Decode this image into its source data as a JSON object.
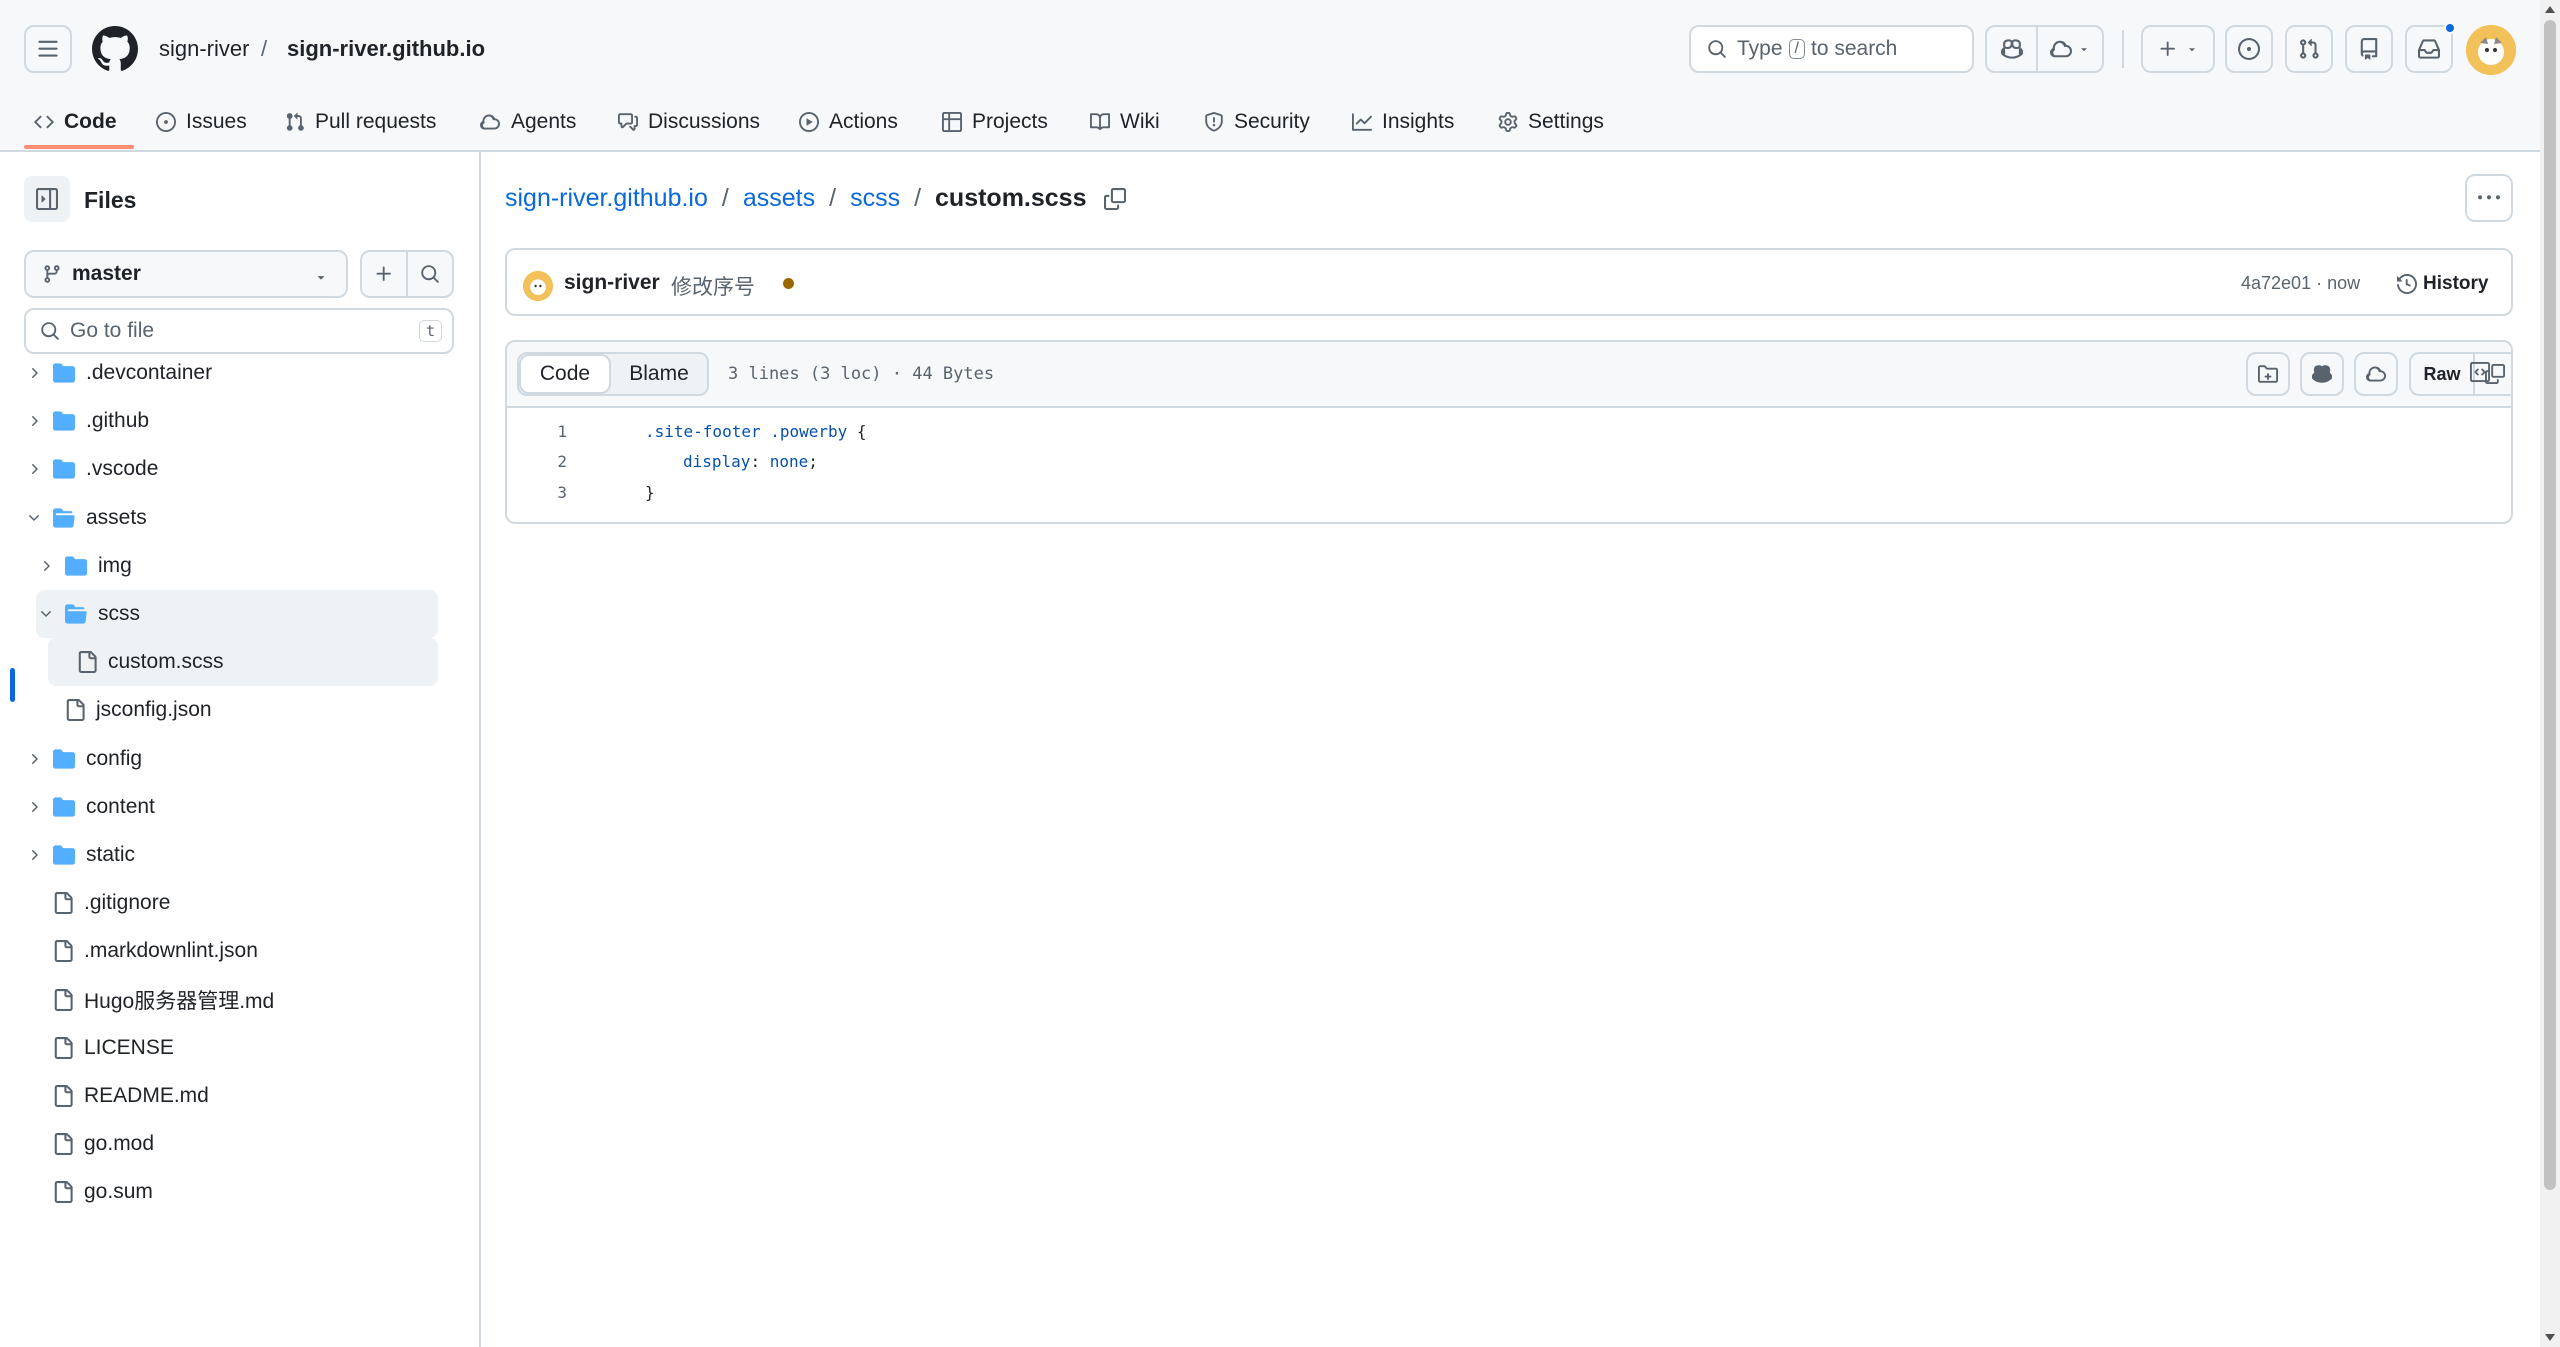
{
  "header": {
    "owner": "sign-river",
    "separator": "/",
    "repo": "sign-river.github.io",
    "search_prefix": "Type",
    "search_key": "/",
    "search_suffix": "to search"
  },
  "repo_nav": [
    {
      "label": "Code",
      "icon": "code-icon",
      "active": true
    },
    {
      "label": "Issues",
      "icon": "issue-icon"
    },
    {
      "label": "Pull requests",
      "icon": "git-pull-request-icon"
    },
    {
      "label": "Agents",
      "icon": "agents-icon"
    },
    {
      "label": "Discussions",
      "icon": "comment-discussion-icon"
    },
    {
      "label": "Actions",
      "icon": "play-icon"
    },
    {
      "label": "Projects",
      "icon": "table-icon"
    },
    {
      "label": "Wiki",
      "icon": "book-icon"
    },
    {
      "label": "Security",
      "icon": "shield-icon"
    },
    {
      "label": "Insights",
      "icon": "graph-icon"
    },
    {
      "label": "Settings",
      "icon": "gear-icon"
    }
  ],
  "sidebar": {
    "title": "Files",
    "branch": "master",
    "goto_placeholder": "Go to file",
    "goto_key": "t",
    "tree": [
      {
        "name": ".devcontainer",
        "type": "folder",
        "depth": 0,
        "expanded": false
      },
      {
        "name": ".github",
        "type": "folder",
        "depth": 0,
        "expanded": false
      },
      {
        "name": ".vscode",
        "type": "folder",
        "depth": 0,
        "expanded": false
      },
      {
        "name": "assets",
        "type": "folder",
        "depth": 0,
        "expanded": true
      },
      {
        "name": "img",
        "type": "folder",
        "depth": 1,
        "expanded": false
      },
      {
        "name": "scss",
        "type": "folder",
        "depth": 1,
        "expanded": true
      },
      {
        "name": "custom.scss",
        "type": "file",
        "depth": 2,
        "selected": true
      },
      {
        "name": "jsconfig.json",
        "type": "file",
        "depth": 1
      },
      {
        "name": "config",
        "type": "folder",
        "depth": 0,
        "expanded": false
      },
      {
        "name": "content",
        "type": "folder",
        "depth": 0,
        "expanded": false
      },
      {
        "name": "static",
        "type": "folder",
        "depth": 0,
        "expanded": false
      },
      {
        "name": ".gitignore",
        "type": "file",
        "depth": 0
      },
      {
        "name": ".markdownlint.json",
        "type": "file",
        "depth": 0
      },
      {
        "name": "Hugo服务器管理.md",
        "type": "file",
        "depth": 0
      },
      {
        "name": "LICENSE",
        "type": "file",
        "depth": 0
      },
      {
        "name": "README.md",
        "type": "file",
        "depth": 0
      },
      {
        "name": "go.mod",
        "type": "file",
        "depth": 0
      },
      {
        "name": "go.sum",
        "type": "file",
        "depth": 0
      }
    ]
  },
  "breadcrumb": {
    "repo": "sign-river.github.io",
    "dir1": "assets",
    "dir2": "scss",
    "file": "custom.scss",
    "sep": "/"
  },
  "commit": {
    "author": "sign-river",
    "message": "修改序号",
    "sha_time": "4a72e01 · now",
    "history_label": "History"
  },
  "code_view": {
    "tab_code": "Code",
    "tab_blame": "Blame",
    "info": "3 lines (3 loc) · 44 Bytes",
    "raw_label": "Raw",
    "lines": [
      {
        "num": "1",
        "indent": 0,
        "parts": [
          {
            "t": ".site-footer .powerby",
            "c": "sel"
          },
          {
            "t": " {",
            "c": "txt"
          }
        ]
      },
      {
        "num": "2",
        "indent": 1,
        "parts": [
          {
            "t": "display",
            "c": "prop"
          },
          {
            "t": ": ",
            "c": "txt"
          },
          {
            "t": "none",
            "c": "prop"
          },
          {
            "t": ";",
            "c": "txt"
          }
        ]
      },
      {
        "num": "3",
        "indent": 0,
        "parts": [
          {
            "t": "}",
            "c": "txt"
          }
        ]
      }
    ]
  },
  "colors": {
    "accent": "#0969da",
    "nav_underline": "#fd8c73",
    "commit_status": "#9a6700"
  }
}
